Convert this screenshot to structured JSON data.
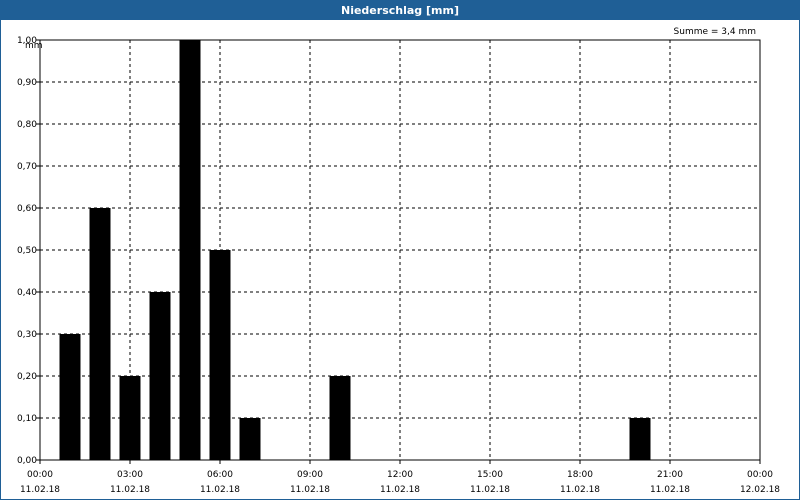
{
  "window": {
    "title": "Niederschlag [mm]"
  },
  "summary": "Summe = 3,4 mm",
  "colors": {
    "titlebar": "#1f5f96",
    "bar": "#000000",
    "grid": "#000000"
  },
  "chart_data": {
    "type": "bar",
    "title": "Niederschlag [mm]",
    "ylabel": "mm",
    "xlabel": "",
    "ylim": [
      0,
      1.0
    ],
    "y_ticks": [
      "0,00",
      "0,10",
      "0,20",
      "0,30",
      "0,40",
      "0,50",
      "0,60",
      "0,70",
      "0,80",
      "0,90",
      "1,00"
    ],
    "x_ticks": [
      {
        "time": "00:00",
        "date": "11.02.18"
      },
      {
        "time": "03:00",
        "date": "11.02.18"
      },
      {
        "time": "06:00",
        "date": "11.02.18"
      },
      {
        "time": "09:00",
        "date": "11.02.18"
      },
      {
        "time": "12:00",
        "date": "11.02.18"
      },
      {
        "time": "15:00",
        "date": "11.02.18"
      },
      {
        "time": "18:00",
        "date": "11.02.18"
      },
      {
        "time": "21:00",
        "date": "11.02.18"
      },
      {
        "time": "00:00",
        "date": "12.02.18"
      }
    ],
    "x_range": [
      "11.02.18 00:00",
      "12.02.18 00:00"
    ],
    "grid": true,
    "bars": [
      {
        "time": "11.02.18 01:00",
        "value": 0.3
      },
      {
        "time": "11.02.18 02:00",
        "value": 0.6
      },
      {
        "time": "11.02.18 03:00",
        "value": 0.2
      },
      {
        "time": "11.02.18 04:00",
        "value": 0.4
      },
      {
        "time": "11.02.18 05:00",
        "value": 1.0
      },
      {
        "time": "11.02.18 06:00",
        "value": 0.5
      },
      {
        "time": "11.02.18 07:00",
        "value": 0.1
      },
      {
        "time": "11.02.18 10:00",
        "value": 0.2
      },
      {
        "time": "11.02.18 20:00",
        "value": 0.1
      }
    ]
  }
}
